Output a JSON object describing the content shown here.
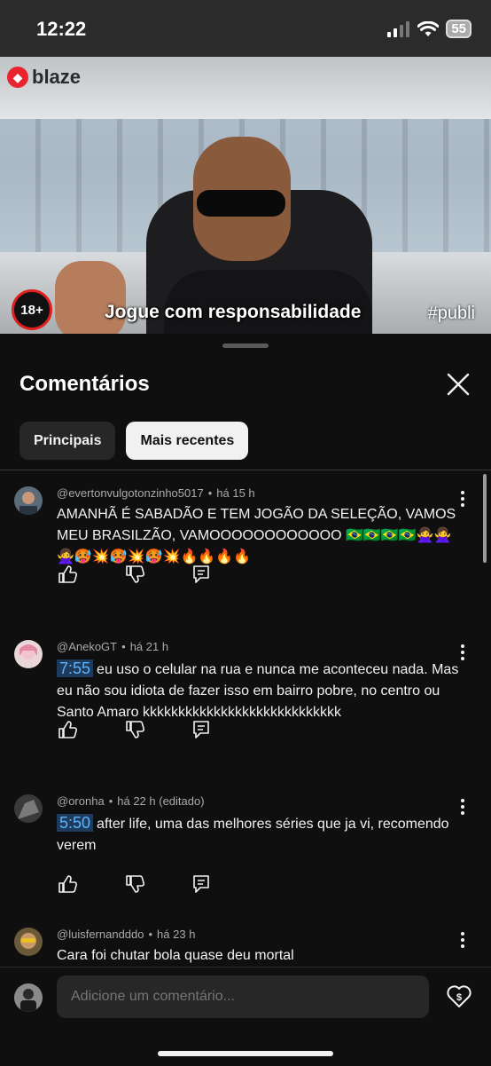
{
  "status_bar": {
    "time": "12:22",
    "battery": "55"
  },
  "video": {
    "brand": "blaze",
    "age_badge": "18+",
    "caption": "Jogue com responsabilidade",
    "tag": "#publi"
  },
  "panel": {
    "title": "Comentários",
    "chips": [
      {
        "label": "Principais",
        "active": false
      },
      {
        "label": "Mais recentes",
        "active": true
      }
    ]
  },
  "comments": [
    {
      "author": "@evertonvulgotonzinho5017",
      "time": "há 15 h",
      "text": "AMANHÃ É SABADÃO E TEM JOGÃO DA SELEÇÃO, VAMOS MEU BRASILZÃO, VAMOOOOOOOOOOOO 🇧🇷🇧🇷🇧🇷🇧🇷🙅‍♀️🙅‍♀️🙅‍♀️🥵💥🥵💥🥵💥🔥🔥🔥🔥"
    },
    {
      "author": "@AnekoGT",
      "time": "há 21 h",
      "timestamp": "7:55",
      "text": "eu uso o celular na rua e nunca me aconteceu nada. Mas eu não sou idiota de fazer isso em bairro pobre, no centro ou Santo Amaro kkkkkkkkkkkkkkkkkkkkkkkkkkkk"
    },
    {
      "author": "@oronha",
      "time": "há 22 h (editado)",
      "timestamp": "5:50",
      "text": "after life, uma das melhores séries que ja vi, recomendo verem"
    },
    {
      "author": "@luisfernandddo",
      "time": "há 23 h",
      "text": "Cara foi chutar bola quase deu mortal"
    }
  ],
  "input": {
    "placeholder": "Adicione um comentário..."
  },
  "colors": {
    "background": "#0f0f0f",
    "timestamp_link": "#5ab4ff",
    "chip_active": "#f1f1f1"
  }
}
